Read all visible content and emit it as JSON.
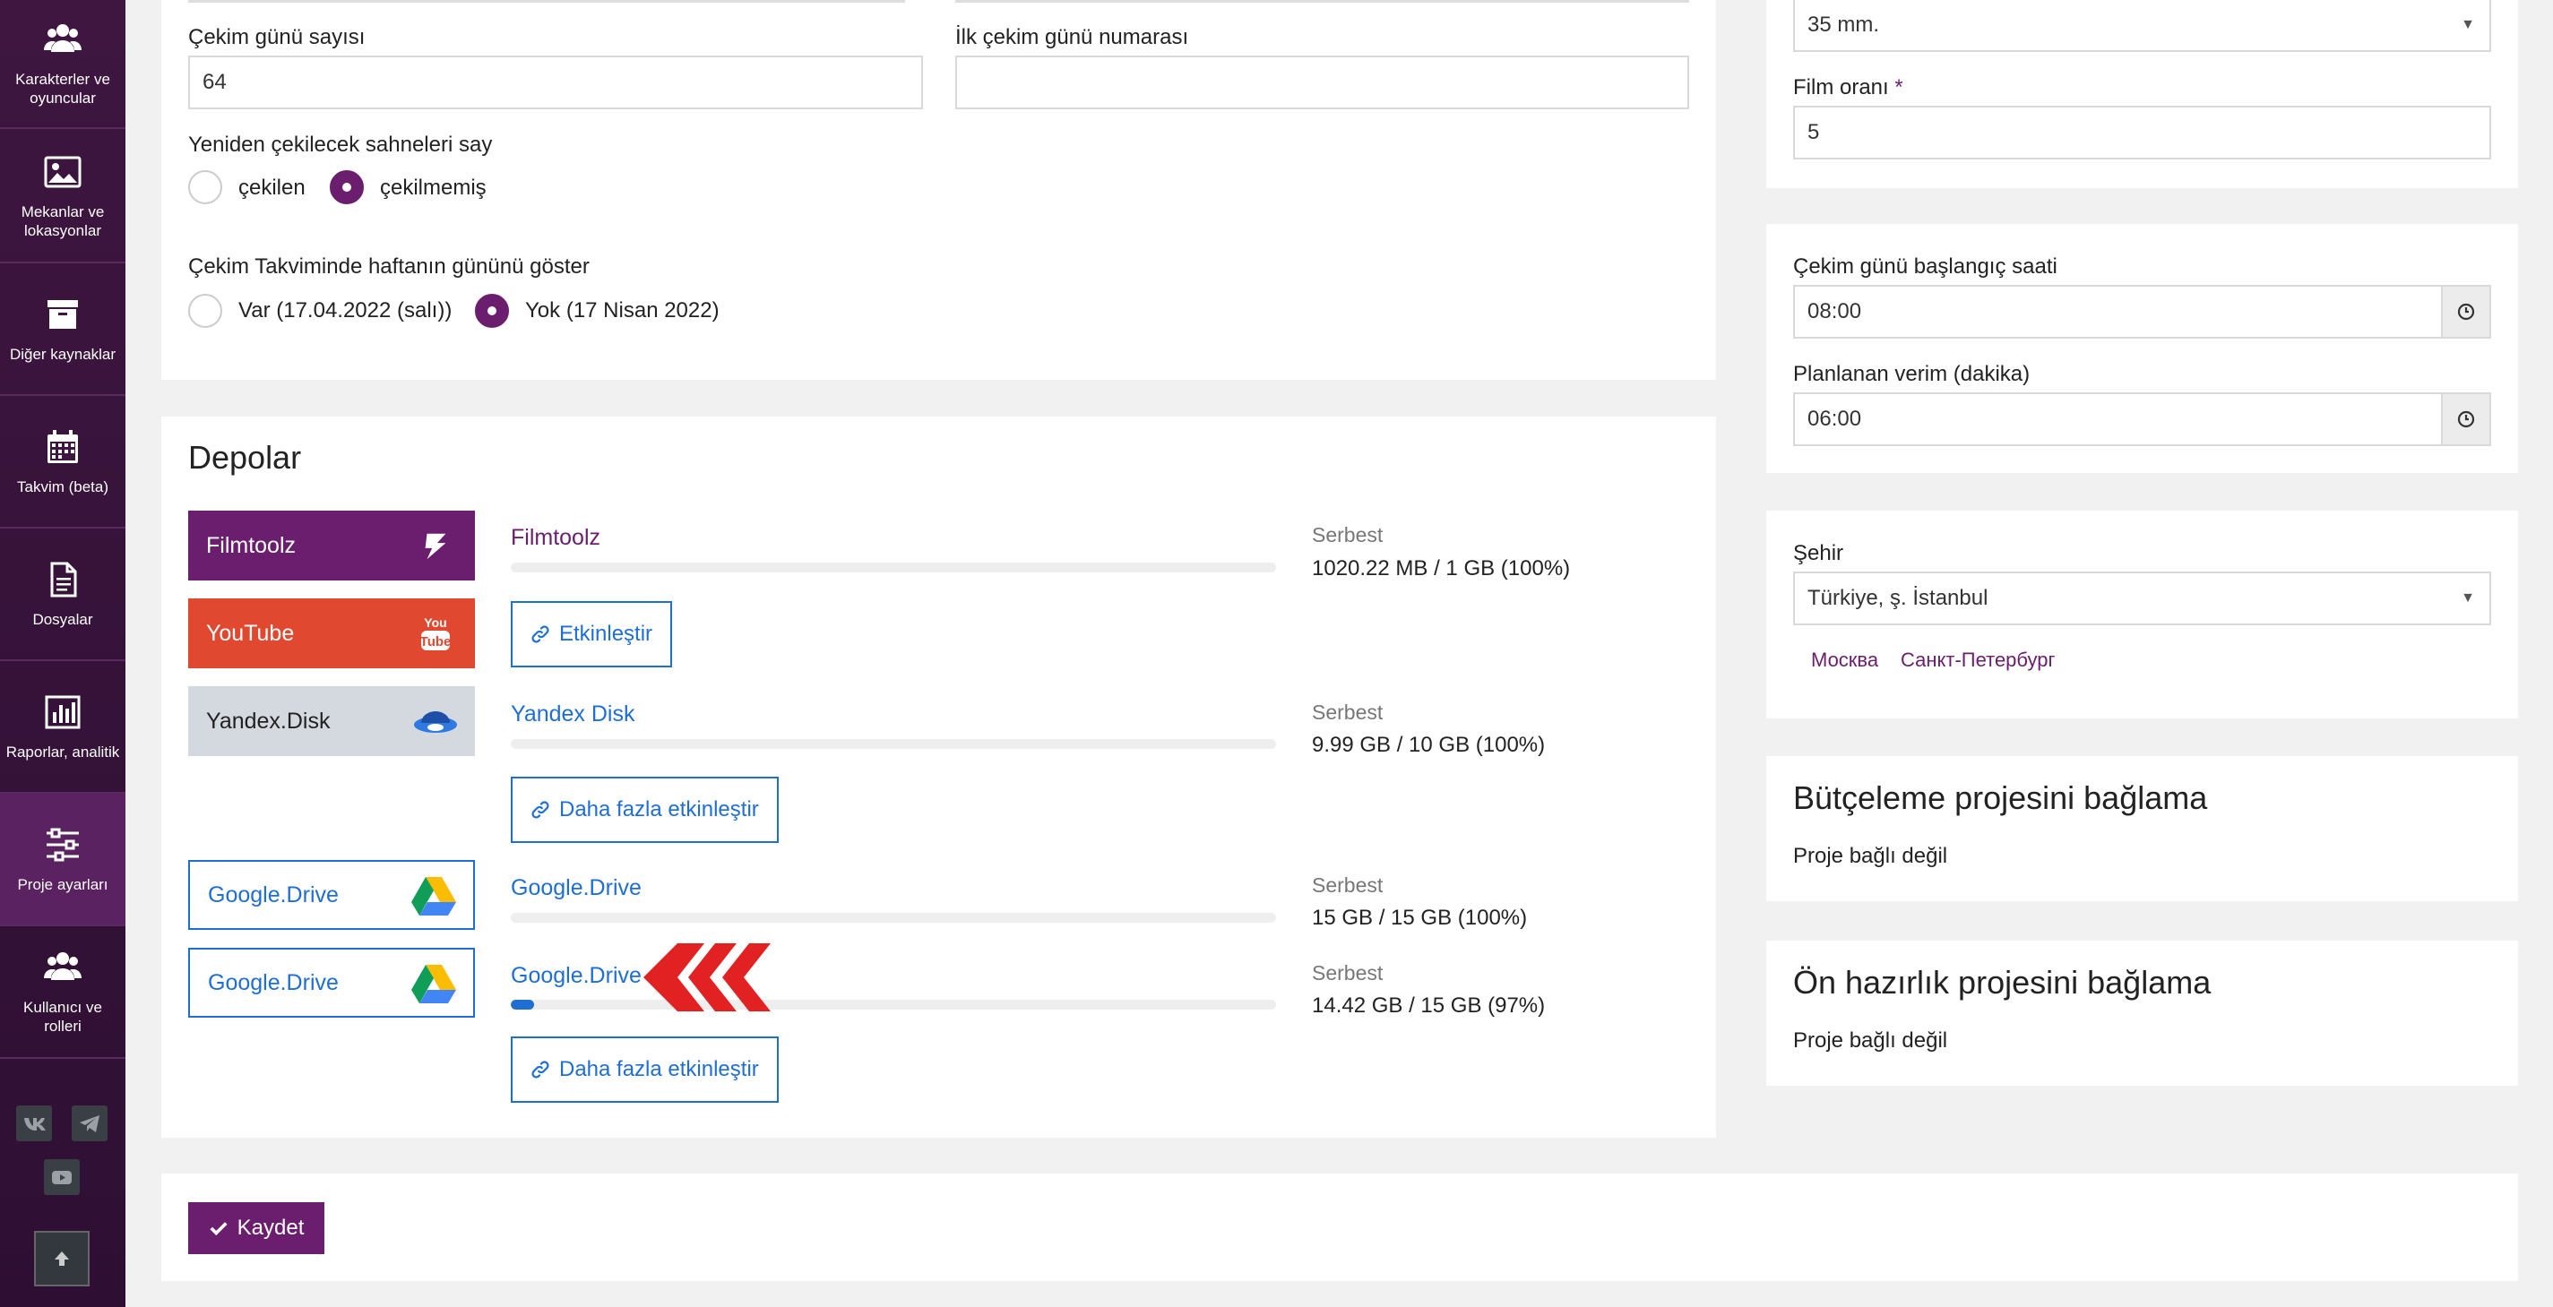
{
  "sidebar": {
    "items": [
      {
        "label": "Karakterler ve oyuncular",
        "icon": "users-icon"
      },
      {
        "label": "Mekanlar ve lokasyonlar",
        "icon": "image-icon"
      },
      {
        "label": "Diğer kaynaklar",
        "icon": "archive-icon"
      },
      {
        "label": "Takvim (beta)",
        "icon": "calendar-icon"
      },
      {
        "label": "Dosyalar",
        "icon": "file-icon"
      },
      {
        "label": "Raporlar, analitik",
        "icon": "chart-icon"
      },
      {
        "label": "Proje ayarları",
        "icon": "sliders-icon",
        "active": true
      },
      {
        "label": "Kullanıcı ve rolleri",
        "icon": "users-icon"
      }
    ],
    "social": [
      "vk-icon",
      "telegram-icon",
      "youtube-icon"
    ]
  },
  "shooting": {
    "days_label": "Çekim günü sayısı",
    "days_value": "64",
    "first_day_label": "İlk çekim günü numarası",
    "first_day_value": "",
    "reshoot_label": "Yeniden çekilecek sahneleri say",
    "reshoot_options": [
      "çekilen",
      "çekilmemiş"
    ],
    "reshoot_selected": "çekilmemiş",
    "weekday_label": "Çekim Takviminde haftanın gününü göster",
    "weekday_options": [
      "Var (17.04.2022 (salı))",
      "Yok (17 Nisan 2022)"
    ],
    "weekday_selected": "Yok (17 Nisan 2022)"
  },
  "storage": {
    "title": "Depolar",
    "free_label": "Serbest",
    "services": [
      {
        "tile": "Filmtoolz",
        "name": "Filmtoolz",
        "free": "1020.22 MB / 1 GB (100%)",
        "used_fraction": 0.0,
        "action": "Etkinleştir"
      },
      {
        "tile": "YouTube"
      },
      {
        "tile": "Yandex.Disk",
        "name": "Yandex Disk",
        "free": "9.99 GB / 10 GB (100%)",
        "used_fraction": 0.0,
        "action": "Daha fazla etkinleştir"
      },
      {
        "tile": "Google.Drive",
        "name": "Google.Drive",
        "free": "15 GB / 15 GB (100%)",
        "used_fraction": 0.0
      },
      {
        "tile": "Google.Drive",
        "name": "Google.Drive",
        "free": "14.42 GB / 15 GB (97%)",
        "used_fraction": 0.03,
        "action": "Daha fazla etkinleştir"
      }
    ]
  },
  "save_label": "Kaydet",
  "right": {
    "format_value": "35 mm.",
    "film_ratio_label": "Film oranı",
    "required_mark": "*",
    "film_ratio_value": "5",
    "start_time_label": "Çekim günü başlangıç saati",
    "start_time_value": "08:00",
    "planned_label": "Planlanan verim (dakika)",
    "planned_value": "06:00",
    "city_label": "Şehir",
    "city_value": "Türkiye, ş. İstanbul",
    "city_links": [
      "Москва",
      "Санкт-Петербург"
    ],
    "budget_title": "Bütçeleme projesini bağlama",
    "budget_status": "Proje bağlı değil",
    "prep_title": "Ön hazırlık projesini bağlama",
    "prep_status": "Proje bağlı değil"
  },
  "colors": {
    "brand": "#6b1e6e",
    "accent_blue": "#1f6ed4",
    "youtube": "#e0492f",
    "annotation_red": "#e22222"
  }
}
